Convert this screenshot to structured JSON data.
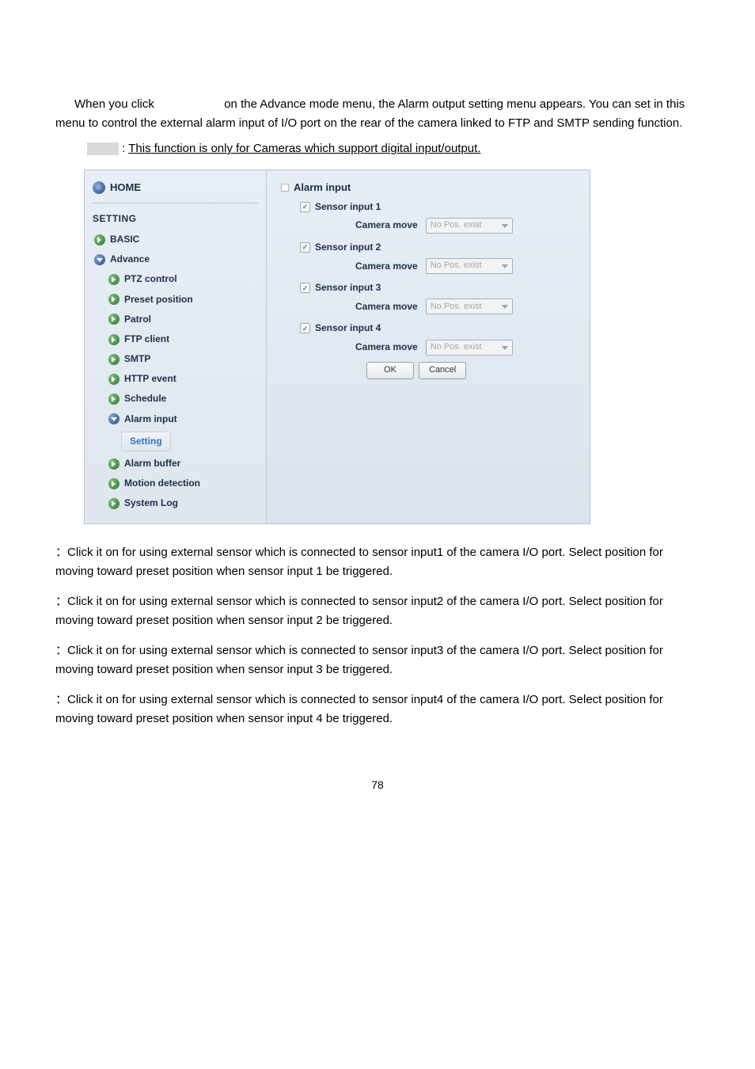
{
  "intro": {
    "p1a": "When you click ",
    "p1b": " on the Advance mode menu, the Alarm output setting menu appears. You can set in this menu to control the external alarm input of I/O port on the rear of the camera linked to FTP and SMTP sending function."
  },
  "note": {
    "prefix": ": ",
    "text": "This function is only for Cameras which support digital input/output."
  },
  "sidebar": {
    "home": "HOME",
    "setting": "SETTING",
    "basic": "BASIC",
    "advance": "Advance",
    "ptz": "PTZ control",
    "preset": "Preset position",
    "patrol": "Patrol",
    "ftp": "FTP client",
    "smtp": "SMTP",
    "http": "HTTP event",
    "schedule": "Schedule",
    "alarm_input": "Alarm input",
    "setting_btn": "Setting",
    "alarm_buffer": "Alarm buffer",
    "motion": "Motion detection",
    "syslog": "System Log"
  },
  "content": {
    "title": "Alarm input",
    "sensor1": "Sensor input 1",
    "sensor2": "Sensor input 2",
    "sensor3": "Sensor input 3",
    "sensor4": "Sensor input 4",
    "camera_move": "Camera move",
    "dropdown": "No Pos. exist",
    "ok": "OK",
    "cancel": "Cancel"
  },
  "body": {
    "s1": "：Click it on for using external sensor which is connected to sensor input1 of the camera I/O port. Select position for moving toward preset position when sensor input 1 be triggered.",
    "s2": "：Click it on for using external sensor which is connected to sensor input2 of the camera I/O port. Select position for moving toward preset position when sensor input 2 be triggered.",
    "s3": "：Click it on for using external sensor which is connected to sensor input3 of the camera I/O port. Select position for moving toward preset position when sensor input 3 be triggered.",
    "s4": "：Click it on for using external sensor which is connected to sensor input4 of the camera I/O port. Select position for moving toward preset position when sensor input 4 be triggered."
  },
  "page_number": "78"
}
